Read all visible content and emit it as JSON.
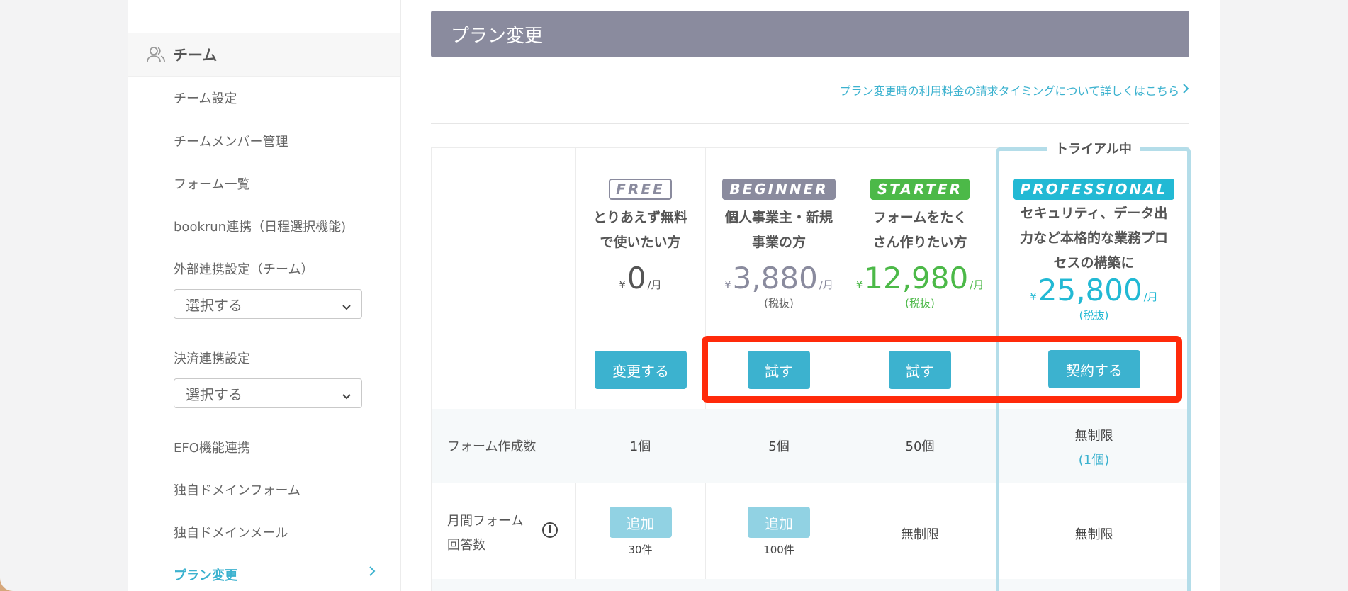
{
  "sidebar": {
    "team_title": "チーム",
    "items": [
      {
        "label": "チーム設定"
      },
      {
        "label": "チームメンバー管理"
      },
      {
        "label": "フォーム一覧"
      },
      {
        "label": "bookrun連携（日程選択機能)"
      },
      {
        "label": "外部連携設定（チーム）"
      },
      {
        "label": "決済連携設定"
      },
      {
        "label": "EFO機能連携"
      },
      {
        "label": "独自ドメインフォーム"
      },
      {
        "label": "独自ドメインメール"
      },
      {
        "label": "プラン変更",
        "active": true
      }
    ],
    "select_external": "選択する",
    "select_payment": "選択する"
  },
  "main": {
    "title": "プラン変更",
    "billing_link": "プラン変更時の利用料金の請求タイミングについて詳しくはこちら",
    "trial_label": "トライアル中",
    "plans": [
      {
        "badge": "FREE",
        "desc": [
          "とりあえず無料",
          "で使いたい方"
        ],
        "yen": "¥",
        "amount": "0",
        "unit": "/月",
        "tax": "",
        "button": "変更する",
        "color": "#8a8b9e"
      },
      {
        "badge": "BEGINNER",
        "desc": [
          "個人事業主・新規",
          "事業の方"
        ],
        "yen": "¥",
        "amount": "3,880",
        "unit": "/月",
        "tax": "(税抜)",
        "button": "試す",
        "color": "#8a8b9e"
      },
      {
        "badge": "STARTER",
        "desc": [
          "フォームをたく",
          "さん作りたい方"
        ],
        "yen": "¥",
        "amount": "12,980",
        "unit": "/月",
        "tax": "(税抜)",
        "button": "試す",
        "color": "#4cb948"
      },
      {
        "badge": "PROFESSIONAL",
        "desc": [
          "セキュリティ、データ出",
          "力など本格的な業務プロ",
          "セスの構築に"
        ],
        "yen": "¥",
        "amount": "25,800",
        "unit": "/月",
        "tax": "(税抜)",
        "button": "契約する",
        "color": "#22b9d4"
      }
    ],
    "rows": {
      "forms": {
        "label": "フォーム作成数",
        "values": [
          "1個",
          "5個",
          "50個",
          "無制限"
        ],
        "pro_sub": "(1個)"
      },
      "monthly": {
        "label_line1": "月間フォーム",
        "label_line2": "回答数",
        "info": "i",
        "add_label": "追加",
        "free_count": "30件",
        "beginner_count": "100件",
        "starter": "無制限",
        "pro": "無制限"
      }
    }
  },
  "colors": {
    "accent": "#3cb2cf",
    "header": "#8a8b9e",
    "highlight": "#ff2a0a"
  }
}
